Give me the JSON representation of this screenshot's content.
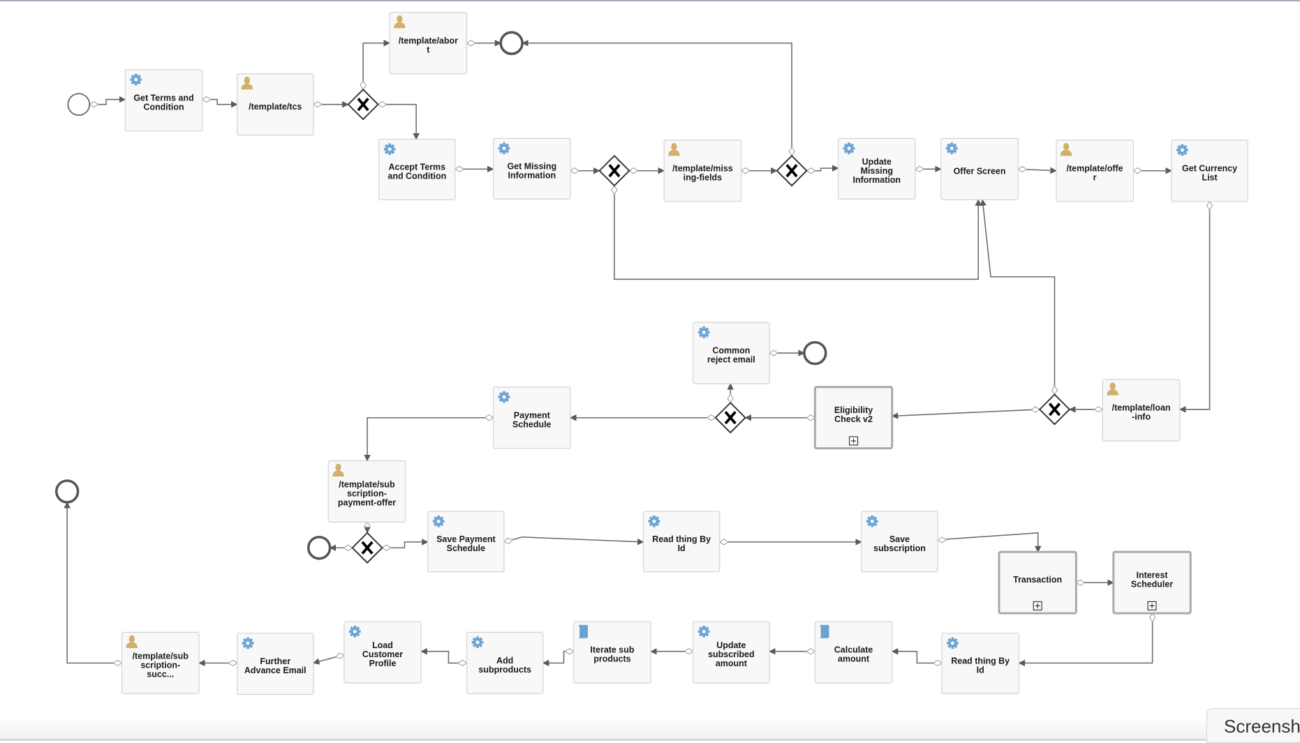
{
  "colors": {
    "service_icon": "#6aa2d4",
    "user_icon": "#d2b069",
    "script_icon": "#6aa2d4",
    "edge": "#6a6a6a"
  },
  "nodes": [
    {
      "id": "t1",
      "type": "service",
      "icon": "gear-icon",
      "label": [
        "Get Terms and",
        "Condition"
      ]
    },
    {
      "id": "t2",
      "type": "user",
      "icon": "user-icon",
      "label": [
        "/template/tcs"
      ]
    },
    {
      "id": "t3",
      "type": "user",
      "icon": "user-icon",
      "label": [
        "/template/abor",
        "t"
      ]
    },
    {
      "id": "t4",
      "type": "service",
      "icon": "gear-icon",
      "label": [
        "Accept Terms",
        "and Condition"
      ]
    },
    {
      "id": "t5",
      "type": "service",
      "icon": "gear-icon",
      "label": [
        "Get Missing",
        "Information"
      ]
    },
    {
      "id": "t6",
      "type": "user",
      "icon": "user-icon",
      "label": [
        "/template/miss",
        "ing-fields"
      ]
    },
    {
      "id": "t7",
      "type": "service",
      "icon": "gear-icon",
      "label": [
        "Update",
        "Missing",
        "Information"
      ]
    },
    {
      "id": "t8",
      "type": "service",
      "icon": "gear-icon",
      "label": [
        "Offer Screen"
      ]
    },
    {
      "id": "t9",
      "type": "user",
      "icon": "user-icon",
      "label": [
        "/template/offe",
        "r"
      ]
    },
    {
      "id": "t10",
      "type": "service",
      "icon": "gear-icon",
      "label": [
        "Get Currency",
        "List"
      ]
    },
    {
      "id": "t11",
      "type": "user",
      "icon": "user-icon",
      "label": [
        "/template/loan",
        "-info"
      ]
    },
    {
      "id": "t12",
      "type": "subprocess",
      "icon": "expand-icon",
      "label": [
        "Eligibility",
        "Check v2"
      ]
    },
    {
      "id": "t13",
      "type": "service",
      "icon": "gear-icon",
      "label": [
        "Common",
        "reject email"
      ]
    },
    {
      "id": "t14",
      "type": "service",
      "icon": "gear-icon",
      "label": [
        "Payment",
        "Schedule"
      ]
    },
    {
      "id": "t15",
      "type": "user",
      "icon": "user-icon",
      "label": [
        "/template/sub",
        "scription-",
        "payment-offer"
      ]
    },
    {
      "id": "t16",
      "type": "service",
      "icon": "gear-icon",
      "label": [
        "Save Payment",
        "Schedule"
      ]
    },
    {
      "id": "t17",
      "type": "service",
      "icon": "gear-icon",
      "label": [
        "Read thing By",
        "Id"
      ]
    },
    {
      "id": "t18",
      "type": "service",
      "icon": "gear-icon",
      "label": [
        "Save",
        "subscription"
      ]
    },
    {
      "id": "t19",
      "type": "subprocess",
      "icon": "expand-icon",
      "label": [
        "Transaction"
      ]
    },
    {
      "id": "t20",
      "type": "subprocess",
      "icon": "expand-icon",
      "label": [
        "Interest",
        "Scheduler"
      ]
    },
    {
      "id": "t21",
      "type": "service",
      "icon": "gear-icon",
      "label": [
        "Read thing By",
        "Id"
      ]
    },
    {
      "id": "t22",
      "type": "script",
      "icon": "script-icon",
      "label": [
        "Calculate",
        "amount"
      ]
    },
    {
      "id": "t23",
      "type": "service",
      "icon": "gear-icon",
      "label": [
        "Update",
        "subscribed",
        "amount"
      ]
    },
    {
      "id": "t24",
      "type": "script",
      "icon": "script-icon",
      "label": [
        "Iterate sub",
        "products"
      ]
    },
    {
      "id": "t25",
      "type": "service",
      "icon": "gear-icon",
      "label": [
        "Add",
        "subproducts"
      ]
    },
    {
      "id": "t26",
      "type": "service",
      "icon": "gear-icon",
      "label": [
        "Load",
        "Customer",
        "Profile"
      ]
    },
    {
      "id": "t27",
      "type": "service",
      "icon": "gear-icon",
      "label": [
        "Further",
        "Advance Email"
      ]
    },
    {
      "id": "t28",
      "type": "user",
      "icon": "user-icon",
      "label": [
        "/template/sub",
        "scription-",
        "succ..."
      ]
    }
  ],
  "gateways": [
    {
      "id": "g1",
      "type": "exclusive"
    },
    {
      "id": "g2",
      "type": "exclusive"
    },
    {
      "id": "g3",
      "type": "exclusive"
    },
    {
      "id": "g4",
      "type": "exclusive"
    },
    {
      "id": "g5",
      "type": "exclusive"
    },
    {
      "id": "g6",
      "type": "exclusive"
    }
  ],
  "events": [
    {
      "id": "start",
      "type": "start"
    },
    {
      "id": "end1",
      "type": "end"
    },
    {
      "id": "end2",
      "type": "end"
    },
    {
      "id": "end3",
      "type": "end"
    },
    {
      "id": "end4",
      "type": "end"
    }
  ],
  "screenshot_button": "Screensh"
}
